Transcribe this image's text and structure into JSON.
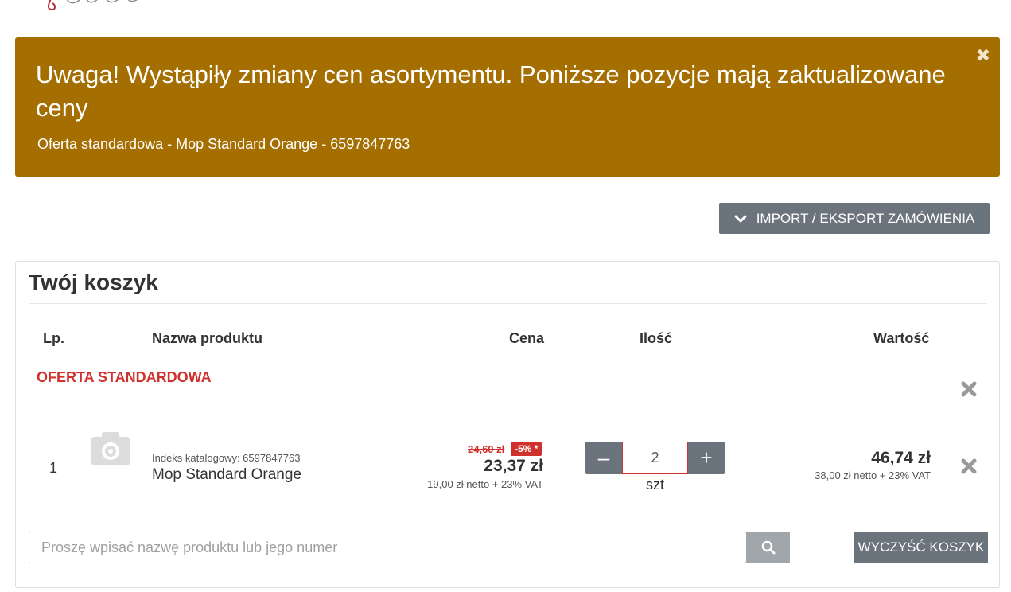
{
  "alert": {
    "title": "Uwaga! Wystąpiły zmiany cen asortymentu. Poniższe pozycje mają zaktualizowane ceny",
    "item": "Oferta standardowa - Mop Standard Orange - 6597847763",
    "close_icon": "close-icon",
    "color": "#a56e00"
  },
  "import_button": {
    "label": "IMPORT / EKSPORT ZAMÓWIENIA",
    "icon": "chevron-down-icon"
  },
  "cart": {
    "title": "Twój koszyk",
    "columns": {
      "lp": "Lp.",
      "name": "Nazwa produktu",
      "price": "Cena",
      "qty": "Ilość",
      "value": "Wartość"
    },
    "offer_label": "OFERTA STANDARDOWA",
    "rows": [
      {
        "lp": "1",
        "index_label": "Indeks katalogowy: 6597847763",
        "name": "Mop Standard Orange",
        "old_price": "24,60 zł",
        "discount": "-5% *",
        "price": "23,37 zł",
        "price_net": "19,00 zł netto + 23% VAT",
        "qty": "2",
        "unit": "szt",
        "value": "46,74 zł",
        "value_net": "38,00 zł netto + 23% VAT"
      }
    ]
  },
  "search": {
    "placeholder": "Proszę wpisać nazwę produktu lub jego numer",
    "icon": "search-icon"
  },
  "clear_button": {
    "label": "WYCZYŚĆ KOSZYK"
  },
  "colors": {
    "accent_red": "#d0312d",
    "button_gray": "#6b737c"
  }
}
